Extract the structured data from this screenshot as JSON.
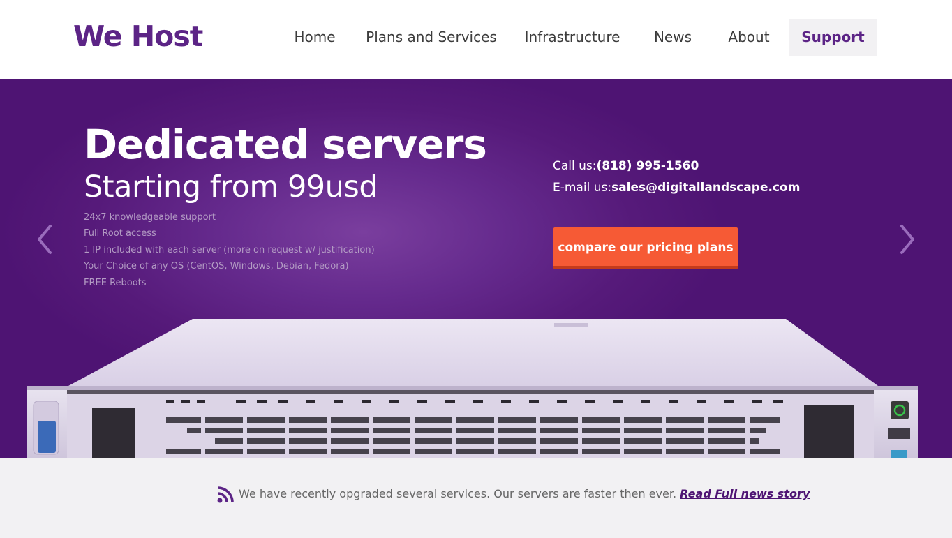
{
  "brand": {
    "logo": "We Host",
    "accent": "#5c2486",
    "cta_color": "#f65a35"
  },
  "nav": {
    "items": [
      {
        "label": "Home",
        "active": false
      },
      {
        "label": "Plans and Services",
        "active": false
      },
      {
        "label": "Infrastructure",
        "active": false
      },
      {
        "label": "News",
        "active": false
      },
      {
        "label": "About",
        "active": false
      },
      {
        "label": "Support",
        "active": true
      }
    ]
  },
  "hero": {
    "title": "Dedicated servers",
    "subtitle": "Starting from 99usd",
    "features": [
      "24x7 knowledgeable support",
      "Full Root access",
      "1 IP included with each server (more on request w/ justification)",
      "Your Choice of any OS (CentOS, Windows, Debian, Fedora)",
      "FREE Reboots"
    ],
    "contact": {
      "phone_label": "Call us:",
      "phone": "(818) 995-1560",
      "email_label": "E-mail us:",
      "email": "sales@digitallandscape.com"
    },
    "cta_label": "compare our pricing plans",
    "prev_icon": "chevron-left-icon",
    "next_icon": "chevron-right-icon"
  },
  "news": {
    "icon": "rss-icon",
    "text": "We have recently opgraded several services. Our servers are faster then ever.",
    "link": "Read Full news story"
  }
}
